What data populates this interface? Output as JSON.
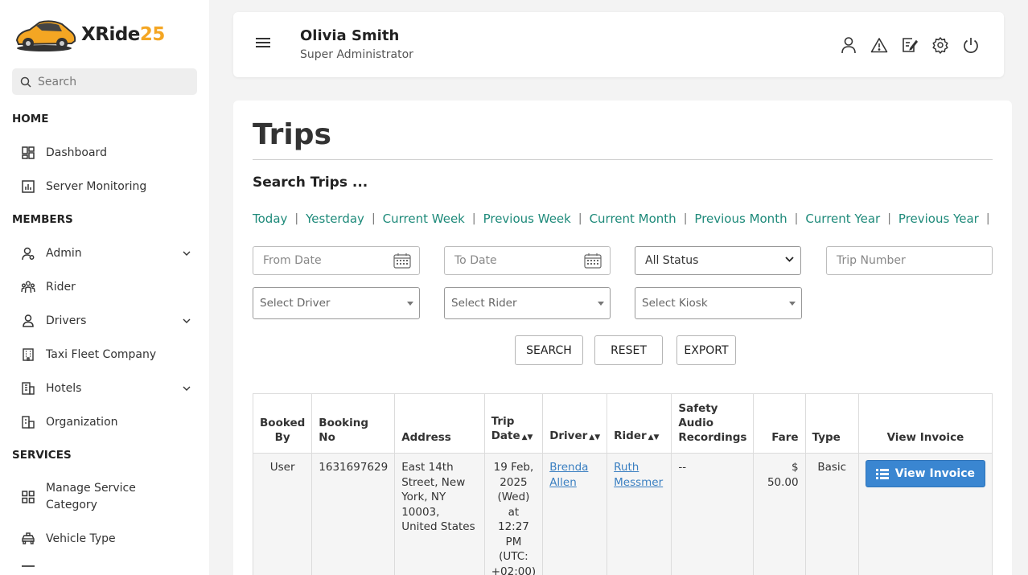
{
  "brand": {
    "name_prefix": "XRide",
    "name_suffix": "25"
  },
  "sidebar": {
    "search_placeholder": "Search",
    "sections": {
      "home": "HOME",
      "members": "MEMBERS",
      "services": "SERVICES"
    },
    "items": {
      "dashboard": "Dashboard",
      "server_monitoring": "Server Monitoring",
      "admin": "Admin",
      "rider": "Rider",
      "drivers": "Drivers",
      "taxi_fleet_company": "Taxi Fleet Company",
      "hotels": "Hotels",
      "organization": "Organization",
      "manage_service_category_line1": "Manage Service",
      "manage_service_category_line2": "Category",
      "vehicle_type": "Vehicle Type"
    }
  },
  "header": {
    "user_name": "Olivia Smith",
    "user_role": "Super Administrator",
    "icons": [
      "user-icon",
      "alert-icon",
      "edit-icon",
      "settings-icon",
      "power-icon"
    ]
  },
  "main": {
    "title": "Trips",
    "search_title": "Search Trips ...",
    "quick_filters": [
      "Today",
      "Yesterday",
      "Current Week",
      "Previous Week",
      "Current Month",
      "Previous Month",
      "Current Year",
      "Previous Year"
    ],
    "filters": {
      "from_date_placeholder": "From Date",
      "to_date_placeholder": "To Date",
      "status_value": "All Status",
      "trip_number_placeholder": "Trip Number",
      "driver_placeholder": "Select Driver",
      "rider_placeholder": "Select Rider",
      "kiosk_placeholder": "Select Kiosk"
    },
    "buttons": {
      "search": "SEARCH",
      "reset": "RESET",
      "export": "EXPORT"
    },
    "table": {
      "headers": {
        "booked_by_1": "Booked",
        "booked_by_2": "By",
        "booking_no": "Booking No",
        "address": "Address",
        "trip_date_1": "Trip",
        "trip_date_2": "Date",
        "driver": "Driver",
        "rider": "Rider",
        "safety_1": "Safety",
        "safety_2": "Audio",
        "safety_3": "Recordings",
        "fare": "Fare",
        "type": "Type",
        "view_invoice": "View Invoice"
      },
      "rows": [
        {
          "booked_by": "User",
          "booking_no": "1631697629",
          "address": "East 14th Street, New York, NY 10003, United States",
          "trip_date_1": "19 Feb,",
          "trip_date_2": "2025",
          "trip_date_3": "(Wed)",
          "trip_date_4": "at 12:27",
          "trip_date_5": "PM",
          "trip_date_6": "(UTC:",
          "trip_date_7": "+02:00)",
          "driver_1": "Brenda",
          "driver_2": "Allen",
          "rider_1": "Ruth",
          "rider_2": "Messmer",
          "safety": "--",
          "fare": "$ 50.00",
          "type": "Basic",
          "invoice_label": "View Invoice"
        }
      ]
    }
  }
}
